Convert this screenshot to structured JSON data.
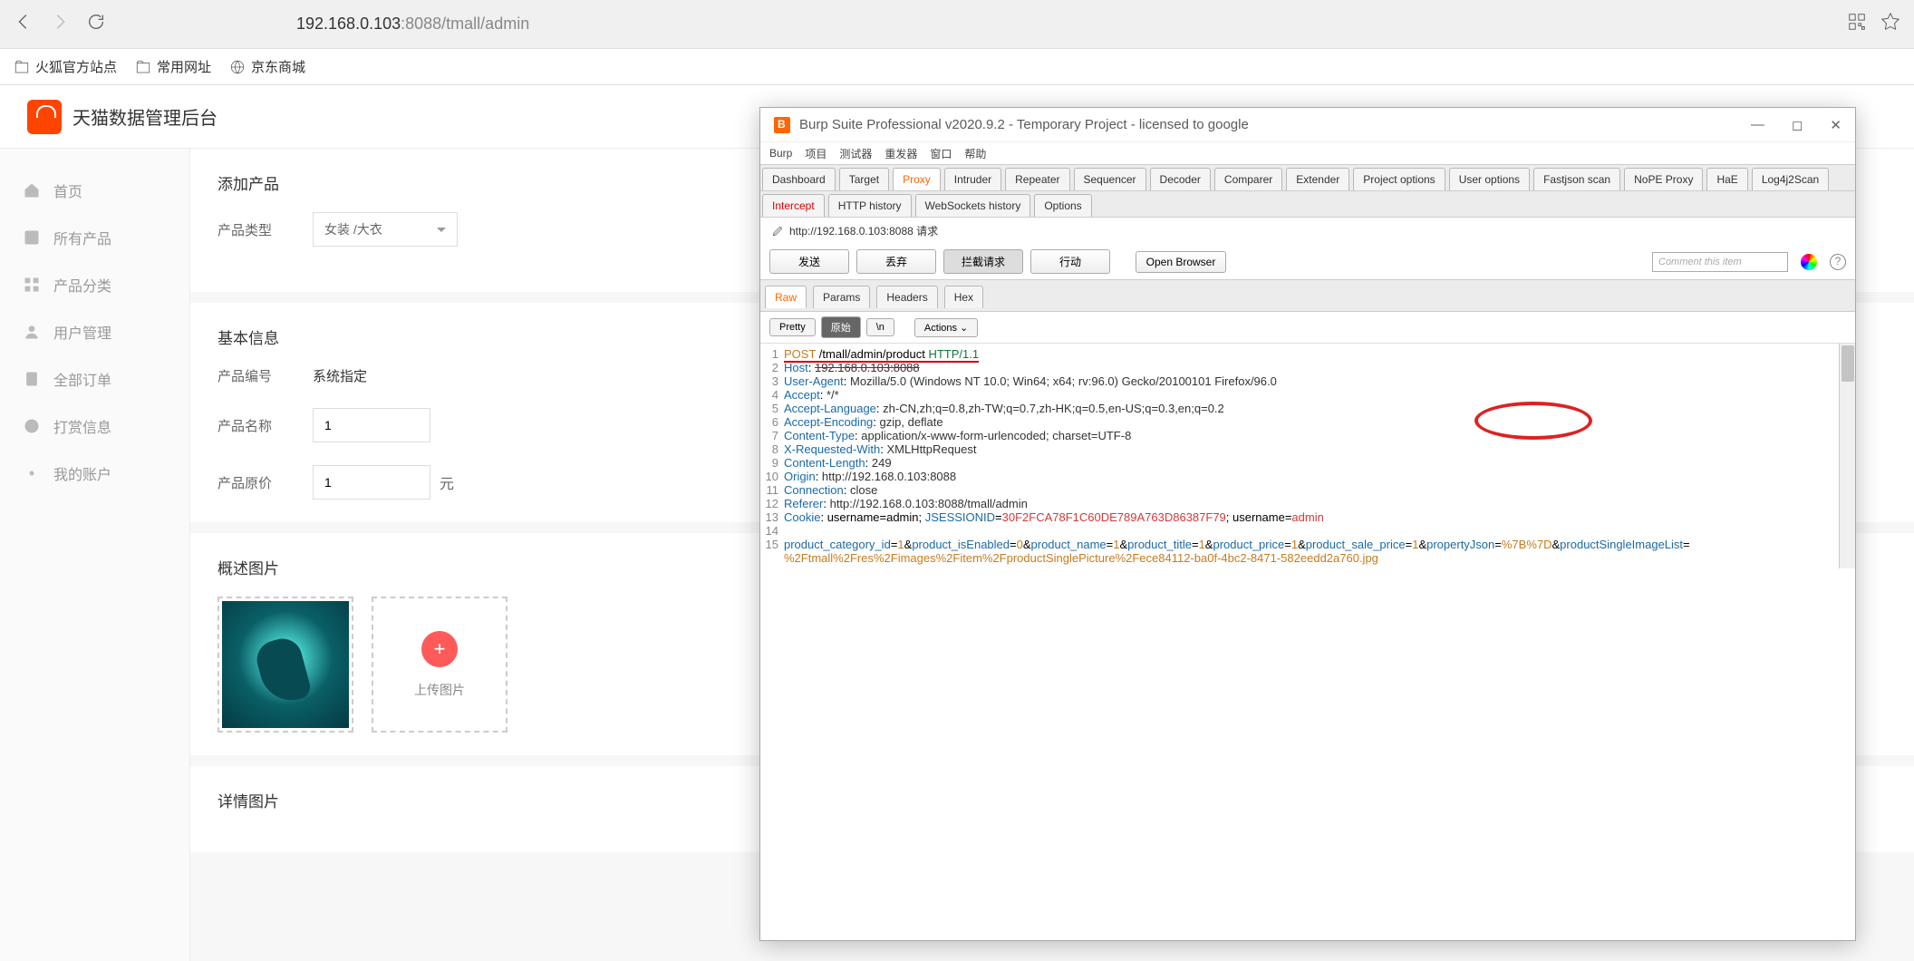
{
  "browser": {
    "url_prefix": "192.168.0.103",
    "url_port": ":8088",
    "url_path": "/tmall/admin",
    "bookmarks": [
      "火狐官方站点",
      "常用网址",
      "京东商城"
    ]
  },
  "app": {
    "title": "天猫数据管理后台",
    "sidebar": [
      {
        "label": "首页"
      },
      {
        "label": "所有产品"
      },
      {
        "label": "产品分类"
      },
      {
        "label": "用户管理"
      },
      {
        "label": "全部订单"
      },
      {
        "label": "打赏信息"
      },
      {
        "label": "我的账户"
      }
    ],
    "section_add": "添加产品",
    "label_type": "产品类型",
    "value_type": "女装 /大衣",
    "section_basic": "基本信息",
    "label_id": "产品编号",
    "value_id": "系统指定",
    "label_name": "产品名称",
    "value_name": "1",
    "label_price": "产品原价",
    "value_price": "1",
    "unit_yuan": "元",
    "section_img": "概述图片",
    "upload_text": "上传图片",
    "section_detail": "详情图片"
  },
  "burp": {
    "title": "Burp Suite Professional v2020.9.2 - Temporary Project - licensed to google",
    "menu": [
      "Burp",
      "项目",
      "测试器",
      "重发器",
      "窗口",
      "帮助"
    ],
    "tabs": [
      "Dashboard",
      "Target",
      "Proxy",
      "Intruder",
      "Repeater",
      "Sequencer",
      "Decoder",
      "Comparer",
      "Extender",
      "Project options",
      "User options",
      "Fastjson scan",
      "NoPE Proxy",
      "HaE",
      "Log4j2Scan"
    ],
    "tab_active": "Proxy",
    "subtabs": [
      "Intercept",
      "HTTP history",
      "WebSockets history",
      "Options"
    ],
    "subtab_active": "Intercept",
    "info_line": "http://192.168.0.103:8088 请求",
    "actions": {
      "send": "发送",
      "drop": "丢弃",
      "intercept": "拦截请求",
      "action": "行动",
      "open": "Open Browser"
    },
    "comment_placeholder": "Comment this item",
    "viewtabs": [
      "Raw",
      "Params",
      "Headers",
      "Hex"
    ],
    "viewtab_active": "Raw",
    "toggles": {
      "pretty": "Pretty",
      "raw": "原始",
      "n": "\\n",
      "actions": "Actions ⌄"
    },
    "request": {
      "line1_a": "POST",
      "line1_b": " /tmall/admin/product ",
      "line1_c": "HTTP/1.1",
      "lines": [
        {
          "n": "2",
          "k": "Host",
          "v": "192.168.0.103:8088",
          "strike": true
        },
        {
          "n": "3",
          "k": "User-Agent",
          "v": "Mozilla/5.0 (Windows NT 10.0; Win64; x64; rv:96.0) Gecko/20100101 Firefox/96.0"
        },
        {
          "n": "4",
          "k": "Accept",
          "v": "*/*"
        },
        {
          "n": "5",
          "k": "Accept-Language",
          "v": "zh-CN,zh;q=0.8,zh-TW;q=0.7,zh-HK;q=0.5,en-US;q=0.3,en;q=0.2"
        },
        {
          "n": "6",
          "k": "Accept-Encoding",
          "v": "gzip, deflate"
        },
        {
          "n": "7",
          "k": "Content-Type",
          "v": "application/x-www-form-urlencoded; charset=UTF-8"
        },
        {
          "n": "8",
          "k": "X-Requested-With",
          "v": "XMLHttpRequest"
        },
        {
          "n": "9",
          "k": "Content-Length",
          "v": "249"
        },
        {
          "n": "10",
          "k": "Origin",
          "v": "http://192.168.0.103:8088"
        },
        {
          "n": "11",
          "k": "Connection",
          "v": "close"
        },
        {
          "n": "12",
          "k": "Referer",
          "v": "http://192.168.0.103:8088/tmall/admin"
        }
      ],
      "cookie_n": "13",
      "cookie_k": "Cookie",
      "cookie_v1": "username=admin; ",
      "cookie_k2": "JSESSIONID",
      "cookie_v2": "=",
      "cookie_v3": "30F2FCA78F1C60DE789A763D86387F79",
      "cookie_v4": "; username=",
      "cookie_v5": "admin",
      "body_n": "15",
      "body_params": [
        {
          "k": "product_category_id",
          "v": "1"
        },
        {
          "k": "product_isEnabled",
          "v": "0"
        },
        {
          "k": "product_name",
          "v": "1"
        },
        {
          "k": "product_title",
          "v": "1"
        },
        {
          "k": "product_price",
          "v": "1"
        },
        {
          "k": "product_sale_price",
          "v": "1"
        },
        {
          "k": "propertyJson",
          "v": "%7B%7D"
        },
        {
          "k": "productSingleImageList",
          "v": ""
        }
      ],
      "body_line2": "%2Ftmall%2Fres%2Fimages%2Fitem%2FproductSinglePicture%2Fece84112-ba0f-4bc2-8471-582eedd2a760.jpg"
    }
  }
}
